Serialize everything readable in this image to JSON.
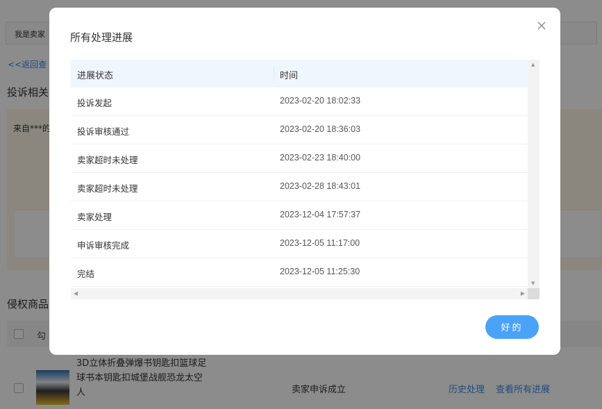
{
  "background": {
    "top_tab_label": "我是卖家",
    "back_link": "<<返回查",
    "complaint_section_title": "投诉相关",
    "warning_text": "来自***的",
    "infringing_section_title": "侵权商品",
    "table_header_partial": "勾",
    "product": {
      "name": "3D立体折叠弹爆书钥匙扣篮球足球书本钥匙扣城堡战舰恐龙太空人",
      "status": "卖家申诉成立",
      "actions": [
        "历史处理",
        "查看所有进展"
      ]
    }
  },
  "modal": {
    "title": "所有处理进展",
    "columns": [
      "进展状态",
      "时间"
    ],
    "rows": [
      {
        "status": "投诉发起",
        "time": "2023-02-20 18:02:33"
      },
      {
        "status": "投诉审核通过",
        "time": "2023-02-20 18:36:03"
      },
      {
        "status": "卖家超时未处理",
        "time": "2023-02-23 18:40:00"
      },
      {
        "status": "卖家超时未处理",
        "time": "2023-02-28 18:43:01"
      },
      {
        "status": "卖家处理",
        "time": "2023-12-04 17:57:37"
      },
      {
        "status": "申诉审核完成",
        "time": "2023-12-05 11:17:00"
      },
      {
        "status": "完结",
        "time": "2023-12-05 11:25:30"
      }
    ],
    "ok_button": "好的"
  },
  "colors": {
    "accent": "#4ba3f7",
    "link": "#3b8ae6",
    "header_bg": "#f0f6fd"
  }
}
